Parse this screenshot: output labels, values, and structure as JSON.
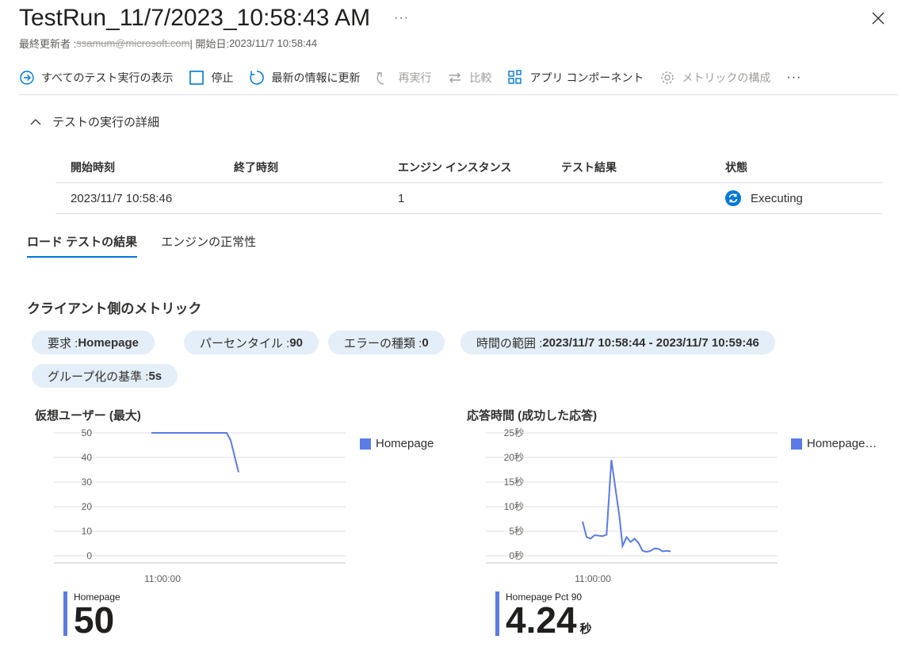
{
  "header": {
    "title": "TestRun_11/7/2023_10:58:43 AM",
    "more": "···",
    "modified_by_label": "最終更新者 : ",
    "modified_by_value": "ssamum@microsoft.com",
    "start_label": "| 開始日: ",
    "start_value": "2023/11/7 10:58:44"
  },
  "toolbar": {
    "items": [
      {
        "label": "すべてのテスト実行の表示",
        "icon": "arrow-circle-icon",
        "enabled": true
      },
      {
        "label": "停止",
        "icon": "stop-icon",
        "enabled": true
      },
      {
        "label": "最新の情報に更新",
        "icon": "refresh-icon",
        "enabled": true
      },
      {
        "label": "再実行",
        "icon": "rerun-icon",
        "enabled": false
      },
      {
        "label": "比較",
        "icon": "compare-icon",
        "enabled": false
      },
      {
        "label": "アプリ コンポーネント",
        "icon": "app-components-icon",
        "enabled": true
      },
      {
        "label": "メトリックの構成",
        "icon": "gear-icon",
        "enabled": false
      }
    ],
    "more": "···"
  },
  "details": {
    "section_label": "テストの実行の詳細",
    "columns": [
      "開始時刻",
      "終了時刻",
      "エンジン インスタンス",
      "テスト結果",
      "状態"
    ],
    "row": {
      "start": "2023/11/7 10:58:46",
      "end": "",
      "engines": "1",
      "result": "",
      "status": "Executing"
    }
  },
  "tabs": [
    "ロード テストの結果",
    "エンジンの正常性"
  ],
  "metrics": {
    "heading": "クライアント側のメトリック",
    "filters": [
      {
        "label": "要求 : ",
        "value": "Homepage"
      },
      {
        "label": "パーセンタイル : ",
        "value": "90"
      },
      {
        "label": "エラーの種類 : ",
        "value": "0"
      },
      {
        "label": "時間の範囲 : ",
        "value": "2023/11/7 10:58:44 - 2023/11/7 10:59:46"
      },
      {
        "label": "グループ化の基準 : ",
        "value": "5s"
      }
    ]
  },
  "colors": {
    "accent": "#0078d4",
    "series": "#5b7be5",
    "pill_bg": "#e3eef8"
  },
  "chart_data": [
    {
      "type": "line",
      "title": "仮想ユーザー (最大)",
      "yticks": [
        "50",
        "40",
        "30",
        "20",
        "10",
        "0"
      ],
      "ylim": [
        0,
        50
      ],
      "xtick": "11:00:00",
      "series": [
        {
          "name": "Homepage",
          "points": [
            [
              0,
              50
            ],
            [
              0.95,
              50
            ],
            [
              1.0,
              47
            ],
            [
              1.1,
              34
            ]
          ]
        }
      ],
      "summary_label": "Homepage",
      "summary_value": "50",
      "summary_unit": ""
    },
    {
      "type": "line",
      "title": "応答時間 (成功した応答)",
      "yticks": [
        "25秒",
        "20秒",
        "15秒",
        "10秒",
        "5秒",
        "0秒"
      ],
      "ylim": [
        0,
        25
      ],
      "xtick": "11:00:00",
      "series": [
        {
          "name": "Homepage…",
          "points": [
            [
              0,
              7
            ],
            [
              0.05,
              3.8
            ],
            [
              0.1,
              3.5
            ],
            [
              0.15,
              4.2
            ],
            [
              0.25,
              4
            ],
            [
              0.3,
              4.3
            ],
            [
              0.36,
              19.5
            ],
            [
              0.46,
              8
            ],
            [
              0.5,
              2
            ],
            [
              0.55,
              3.8
            ],
            [
              0.6,
              2.8
            ],
            [
              0.65,
              3.5
            ],
            [
              0.7,
              2.6
            ],
            [
              0.75,
              1
            ],
            [
              0.8,
              0.8
            ],
            [
              0.85,
              1
            ],
            [
              0.9,
              1.5
            ],
            [
              0.95,
              1.4
            ],
            [
              1.0,
              0.9
            ],
            [
              1.05,
              1
            ],
            [
              1.1,
              0.9
            ]
          ]
        }
      ],
      "summary_label": "Homepage Pct 90",
      "summary_value": "4.24",
      "summary_unit": "秒"
    }
  ]
}
